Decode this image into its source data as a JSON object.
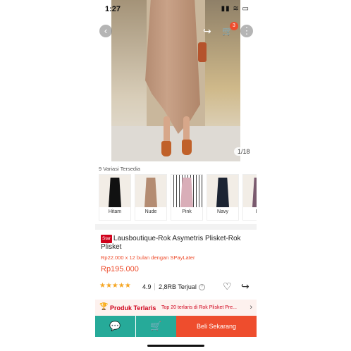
{
  "status_bar": {
    "time": "1:27",
    "icons": "▮▮ ≋ ▭"
  },
  "nav": {
    "back_glyph": "‹",
    "share_glyph": "↪",
    "cart_glyph": "🛒",
    "cart_badge": "3",
    "more_glyph": "⋮"
  },
  "image_counter": "1/18",
  "variations": {
    "title": "9 Variasi Tersedia",
    "items": [
      {
        "label": "Hitam",
        "color": "#111111"
      },
      {
        "label": "Nude",
        "color": "#b48c72"
      },
      {
        "label": "Pink",
        "color": "#d9aeb8"
      },
      {
        "label": "Navy",
        "color": "#1c2433"
      },
      {
        "label": "Pu",
        "color": "#7a5a6e"
      }
    ]
  },
  "product": {
    "badge": "Star",
    "title": "Lausboutique-Rok Asymetris Plisket-Rok Plisket",
    "installment": "Rp22.000 x 12 bulan dengan SPayLater",
    "price": "Rp195.000"
  },
  "rating": {
    "stars": "★★★★★",
    "value": "4.9",
    "sold": "2,8RB Terjual",
    "info": "?"
  },
  "actions": {
    "heart": "♡",
    "share": "↪"
  },
  "promo": {
    "trophy": "🏆",
    "label": "Produk Terlaris",
    "text": "Top 20 terlaris di Rok Plisket Pre...",
    "chevron": "›"
  },
  "bottom": {
    "chat": "💬",
    "cart": "🛒",
    "buy": "Beli Sekarang"
  },
  "colors": {
    "accent": "#ee4d2d",
    "teal": "#26aa99",
    "star": "#f5a623"
  }
}
